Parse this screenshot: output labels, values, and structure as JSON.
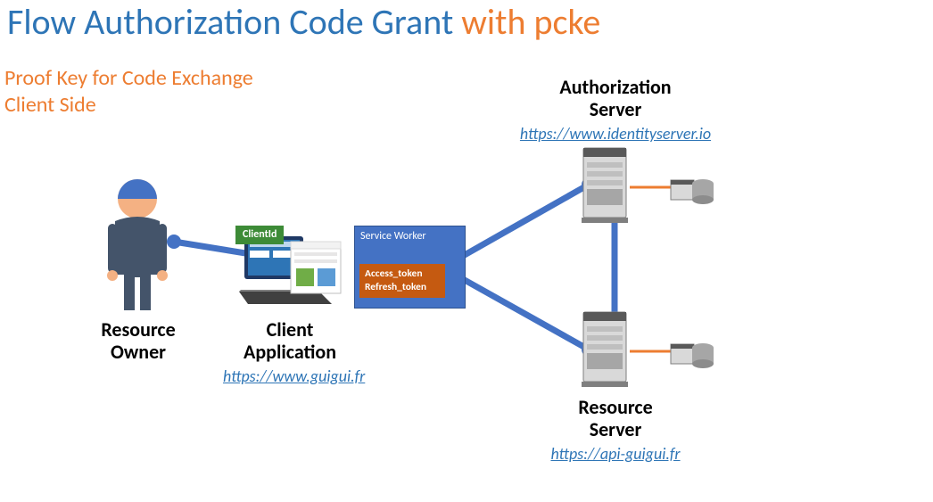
{
  "title": {
    "part1": "Flow Authorization Code Grant ",
    "part2": "with pcke"
  },
  "subtitle": {
    "line1": "Proof Key for Code Exchange",
    "line2": "Client Side"
  },
  "resource_owner": {
    "label_line1": "Resource",
    "label_line2": "Owner"
  },
  "client_app": {
    "label_line1": "Client",
    "label_line2": "Application",
    "url": "https://www.guigui.fr"
  },
  "client_id_badge": "ClientId",
  "service_worker": {
    "title": "Service Worker",
    "token1": "Access_token",
    "token2": "Refresh_token"
  },
  "auth_server": {
    "label_line1": "Authorization",
    "label_line2": "Server",
    "url": "https://www.identityserver.io"
  },
  "resource_server": {
    "label_line1": "Resource",
    "label_line2": "Server",
    "url": "https://api-guigui.fr"
  }
}
